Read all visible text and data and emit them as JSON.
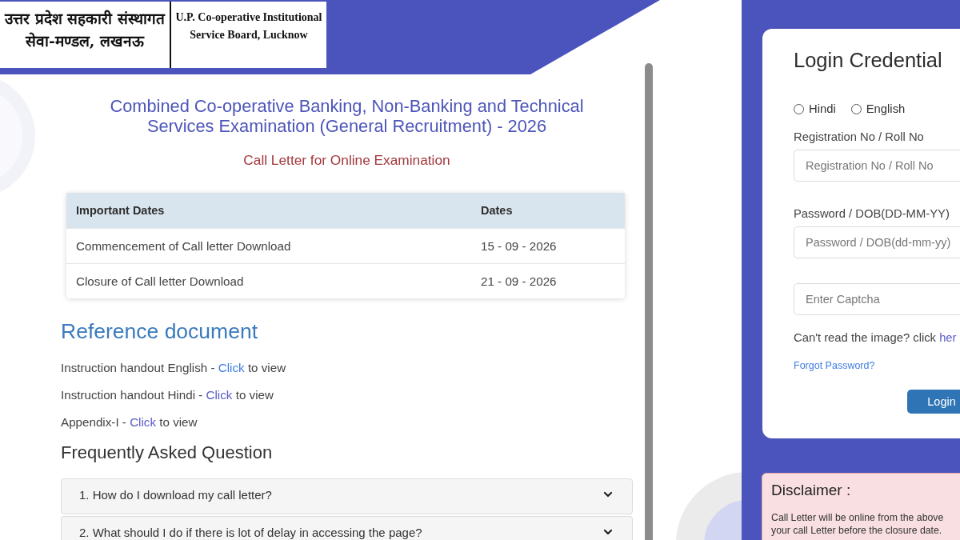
{
  "header": {
    "board_name_hindi_lines": [
      "उत्तर प्रदेश सहकारी संस्थागत",
      "सेवा-मण्डल, लखनऊ"
    ],
    "board_name_english_lines": [
      "U.P. Co-operative Institutional",
      "Service Board, Lucknow"
    ]
  },
  "exam": {
    "title": "Combined Co-operative Banking, Non-Banking and Technical Services Examination (General Recruitment) - 2026",
    "subtitle": "Call Letter for Online Examination"
  },
  "dates_table": {
    "columns": [
      "Important Dates",
      "Dates"
    ],
    "rows": [
      [
        "Commencement of Call letter Download",
        "15 - 09 - 2026"
      ],
      [
        "Closure of Call letter Download",
        "21 - 09 - 2026"
      ]
    ]
  },
  "reference": {
    "heading": "Reference document",
    "documents": [
      {
        "label": "Instruction handout English -",
        "link": "Click",
        "suffix": "to view",
        "visited": false
      },
      {
        "label": "Instruction handout Hindi -",
        "link": "Click",
        "suffix": "to view",
        "visited": true
      },
      {
        "label": "Appendix-I -",
        "link": "Click",
        "suffix": "to view",
        "visited": true
      }
    ]
  },
  "faq": {
    "heading": "Frequently Asked Question",
    "items": [
      {
        "question": "1. How do I download my call letter?",
        "expanded": false
      },
      {
        "question": "2. What should I do if there is lot of delay in accessing the page?",
        "expanded": false
      }
    ]
  },
  "login": {
    "title": "Login Credential",
    "languages": [
      {
        "label": "Hindi",
        "selected": false
      },
      {
        "label": "English",
        "selected": false
      }
    ],
    "fields": [
      {
        "label": "Registration No / Roll No",
        "placeholder": "Registration No / Roll No"
      },
      {
        "label": "Password / DOB(DD-MM-YY)",
        "placeholder": "Password / DOB(dd-mm-yy)"
      },
      {
        "placeholder": "Enter Captcha"
      }
    ],
    "captcha_help": {
      "text": "Can't read the image? click",
      "link": "her"
    },
    "forgot_password": "Forgot Password?",
    "button": "Login"
  },
  "disclaimer": {
    "title": "Disclaimer :",
    "lines": [
      "Call Letter will be online from the above",
      "your call Letter before the closure date."
    ]
  }
}
